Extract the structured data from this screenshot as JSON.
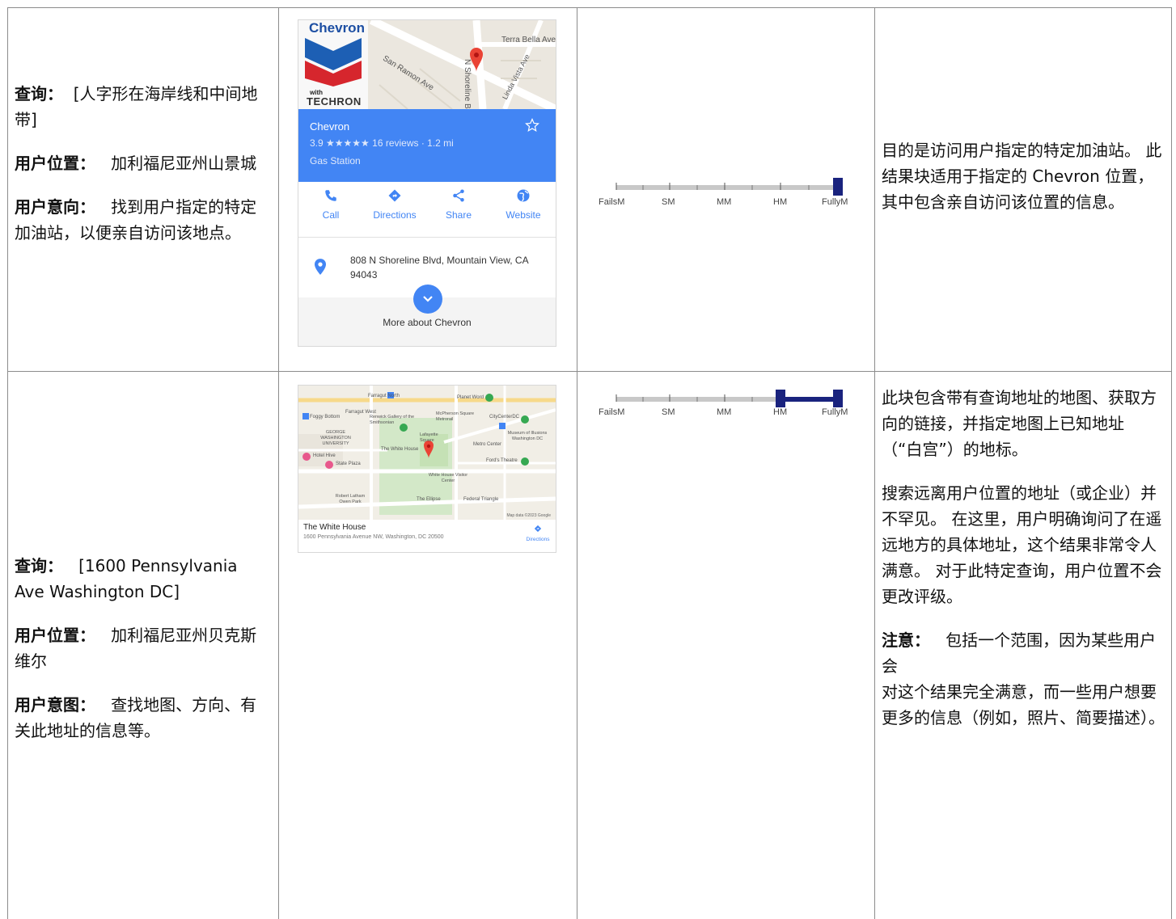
{
  "rows": [
    {
      "query_label": "查询：",
      "query_value": "[人字形在海岸线和中间地带]",
      "location_label": "用户位置：",
      "location_value": "加利福尼亚州山景城",
      "intent_label": "用户意向：",
      "intent_value": "找到用户指定的特定加油站，以便亲自访问该地点。",
      "card": {
        "map_labels": [
          "N Shoreline Blvd",
          "Terra Bella Ave",
          "San Ramon Ave",
          "Linda Vista Ave"
        ],
        "logo_text": "Chevron",
        "logo_with": "with",
        "logo_techron": "TECHRON",
        "name": "Chevron",
        "rating_line": "3.9 ★★★★★ 16 reviews · 1.2 mi",
        "category": "Gas Station",
        "actions": [
          "Call",
          "Directions",
          "Share",
          "Website"
        ],
        "address_line1": "808 N Shoreline Blvd, Mountain View, CA",
        "address_line2": "94043",
        "more": "More about Chevron"
      },
      "rating": {
        "range_from": "FullyM",
        "range_to": "FullyM"
      },
      "comment_paragraphs": [
        "目的是访问用户指定的特定加油站。 此结果块适用于指定的 Chevron 位置，其中包含亲自访问该位置的信息。"
      ]
    },
    {
      "query_label": "查询：",
      "query_value": "[1600 Pennsylvania Ave Washington DC]",
      "location_label": "用户位置：",
      "location_value": "加利福尼亚州贝克斯维尔",
      "intent_label": "用户意图：",
      "intent_value": "查找地图、方向、有关此地址的信息等。",
      "card": {
        "map_labels": [
          "Farragut North",
          "Farragut West",
          "Foggy Bottom",
          "Renwick Gallery of the Smithsonian",
          "McPherson Square Metrorail",
          "CityCenterDC",
          "Planet Word",
          "GEORGE WASHINGTON UNIVERSITY",
          "The White House",
          "Lafayette Square",
          "Museum of Illusions Washington DC",
          "Metro Center",
          "Hotel Hive",
          "State Plaza",
          "Ford's Theatre",
          "White House Visitor Center",
          "Robert Latham Owen Park",
          "The Ellipse",
          "Federal Triangle",
          "Map data ©2023 Google"
        ],
        "name": "The White House",
        "address": "1600 Pennsylvania Avenue NW, Washington, DC 20500",
        "directions": "Directions"
      },
      "rating": {
        "range_from": "HM",
        "range_to": "FullyM"
      },
      "comment_paragraphs": [
        "此块包含带有查询地址的地图、获取方向的链接，并指定地图上已知地址（“白宫”）的地标。",
        "搜索远离用户位置的地址（或企业）并不罕见。 在这里，用户明确询问了在遥远地方的具体地址，这个结果非常令人满意。 对于此特定查询，用户位置不会更改评级。"
      ],
      "note_label": "注意：",
      "note_value": "包括一个范围，因为某些用户会",
      "note_continued": "对这个结果完全满意，而一些用户想要更多的信息（例如，照片、简要描述）。"
    }
  ],
  "scale_labels": [
    "FailsM",
    "SM",
    "MM",
    "HM",
    "FullyM"
  ],
  "colors": {
    "scale_marker": "#1a237e",
    "scale_track": "#c8c8c8",
    "card_blue": "#4285f4"
  }
}
